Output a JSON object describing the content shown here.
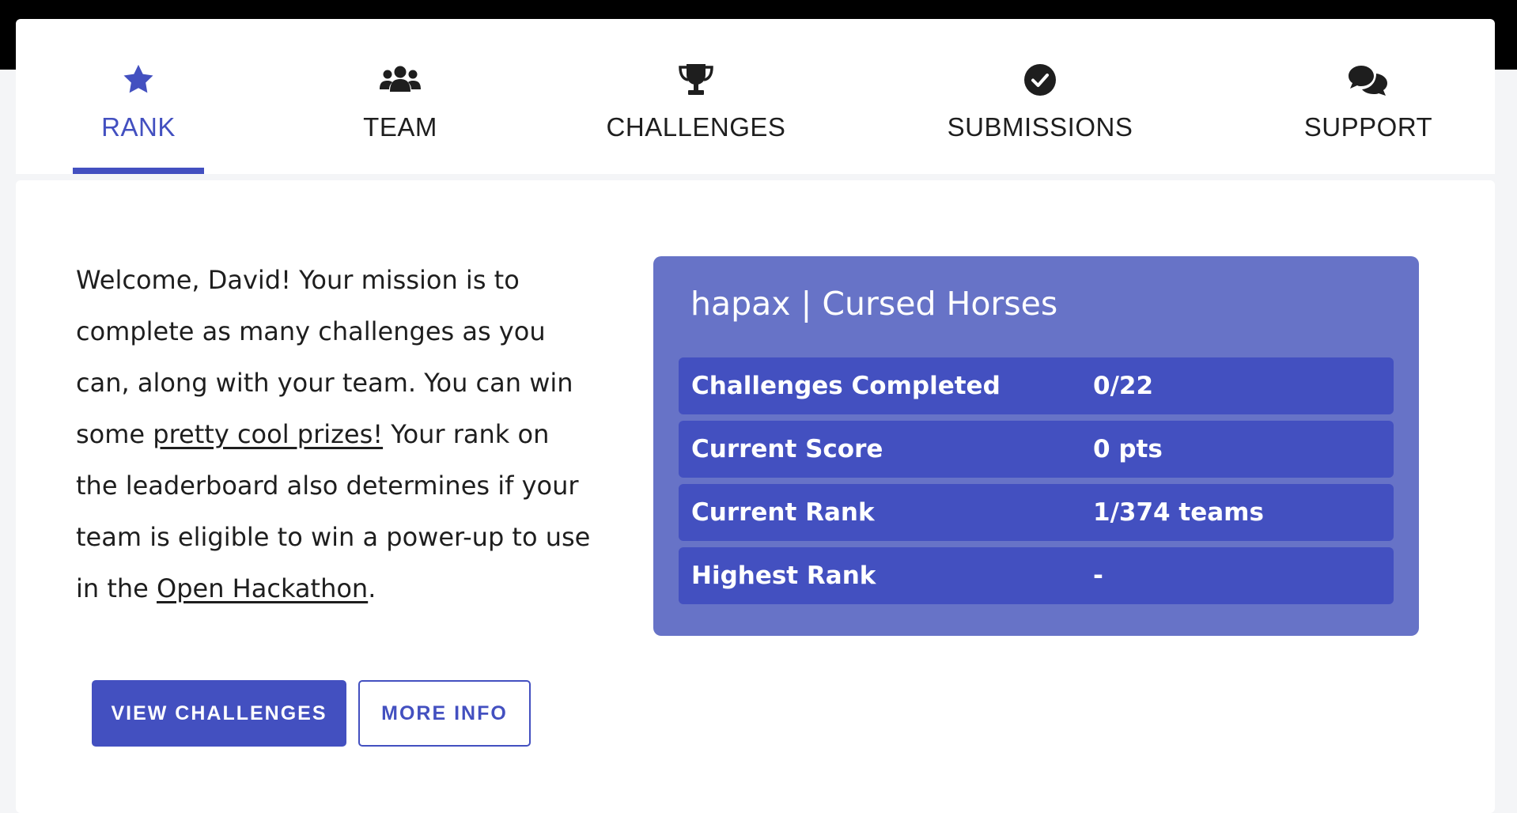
{
  "nav": {
    "tabs": [
      {
        "label": "RANK",
        "icon": "star-icon",
        "active": true
      },
      {
        "label": "TEAM",
        "icon": "users-icon",
        "active": false
      },
      {
        "label": "CHALLENGES",
        "icon": "trophy-icon",
        "active": false
      },
      {
        "label": "SUBMISSIONS",
        "icon": "check-circle-icon",
        "active": false
      },
      {
        "label": "SUPPORT",
        "icon": "comments-icon",
        "active": false
      }
    ]
  },
  "welcome": {
    "intro": "Welcome, David! Your mission is to complete as many challenges as you can, along with your team. You can win some ",
    "prizes_link": "pretty cool prizes!",
    "middle": " Your rank on the leaderboard also determines if your team is eligible to win a power-up to use in the ",
    "hackathon_link": "Open Hackathon",
    "end": "."
  },
  "buttons": {
    "view_challenges": "VIEW CHALLENGES",
    "more_info": "MORE INFO"
  },
  "team": {
    "name": "hapax | Cursed Horses",
    "stats": [
      {
        "label": "Challenges Completed",
        "value": "0/22"
      },
      {
        "label": "Current Score",
        "value": "0 pts"
      },
      {
        "label": "Current Rank",
        "value": "1/374 teams"
      },
      {
        "label": "Highest Rank",
        "value": "-"
      }
    ]
  },
  "colors": {
    "accent": "#4350c0",
    "card": "#6773c7",
    "text": "#1e1e1e"
  }
}
